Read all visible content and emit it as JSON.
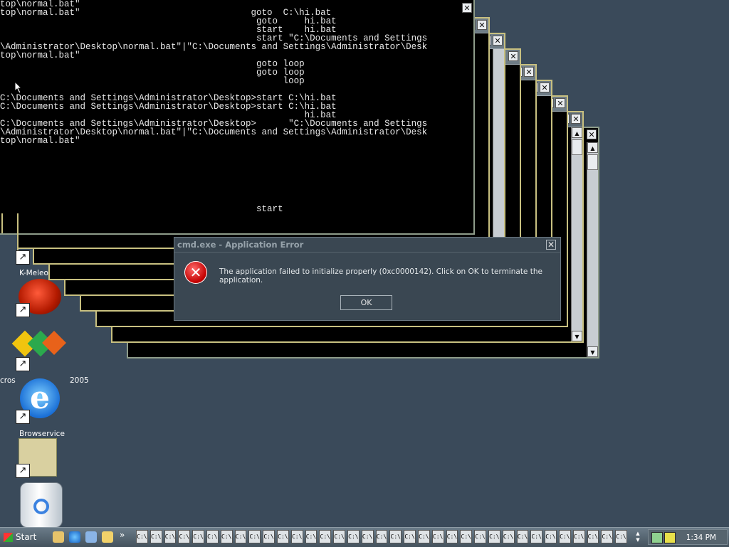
{
  "console": {
    "lines": "top\\normal.bat\"\ntop\\normal.bat\"                                goto  C:\\hi.bat\n                                                goto     hi.bat\n                                                start    hi.bat\n                                                start \"C:\\Documents and Settings\n\\Administrator\\Desktop\\normal.bat\"|\"C:\\Documents and Settings\\Administrator\\Desk\ntop\\normal.bat\"\n                                                goto loop\n                                                goto loop\n                                                     loop\n\nC:\\Documents and Settings\\Administrator\\Desktop>start C:\\hi.bat\nC:\\Documents and Settings\\Administrator\\Desktop>start C:\\hi.bat\n                                                         hi.bat\nC:\\Documents and Settings\\Administrator\\Desktop>      \"C:\\Documents and Settings\n\\Administrator\\Desktop\\normal.bat\"|\"C:\\Documents and Settings\\Administrator\\Desk\ntop\\normal.bat\"\n\n\n\n\n\n\n\n                                                start"
  },
  "dialog": {
    "title": "cmd.exe - Application Error",
    "message": "The application failed to initialize properly (0xc0000142). Click on OK to terminate the application.",
    "ok_label": "OK",
    "close_glyph": "✕",
    "icon_glyph": "✕"
  },
  "desktop_icons": [
    {
      "label": "K-Meleo"
    },
    {
      "label": "cros"
    },
    {
      "label": "2005"
    },
    {
      "label": "Browservice"
    }
  ],
  "taskbar": {
    "start_label": "Start",
    "chevron": "»",
    "task_glyph": "C:\\",
    "task_count": 35,
    "clock": "1:34 PM"
  },
  "colors": {
    "desktop": "#3a4a5a",
    "error_red": "#c40000",
    "console_bg": "#000000"
  }
}
